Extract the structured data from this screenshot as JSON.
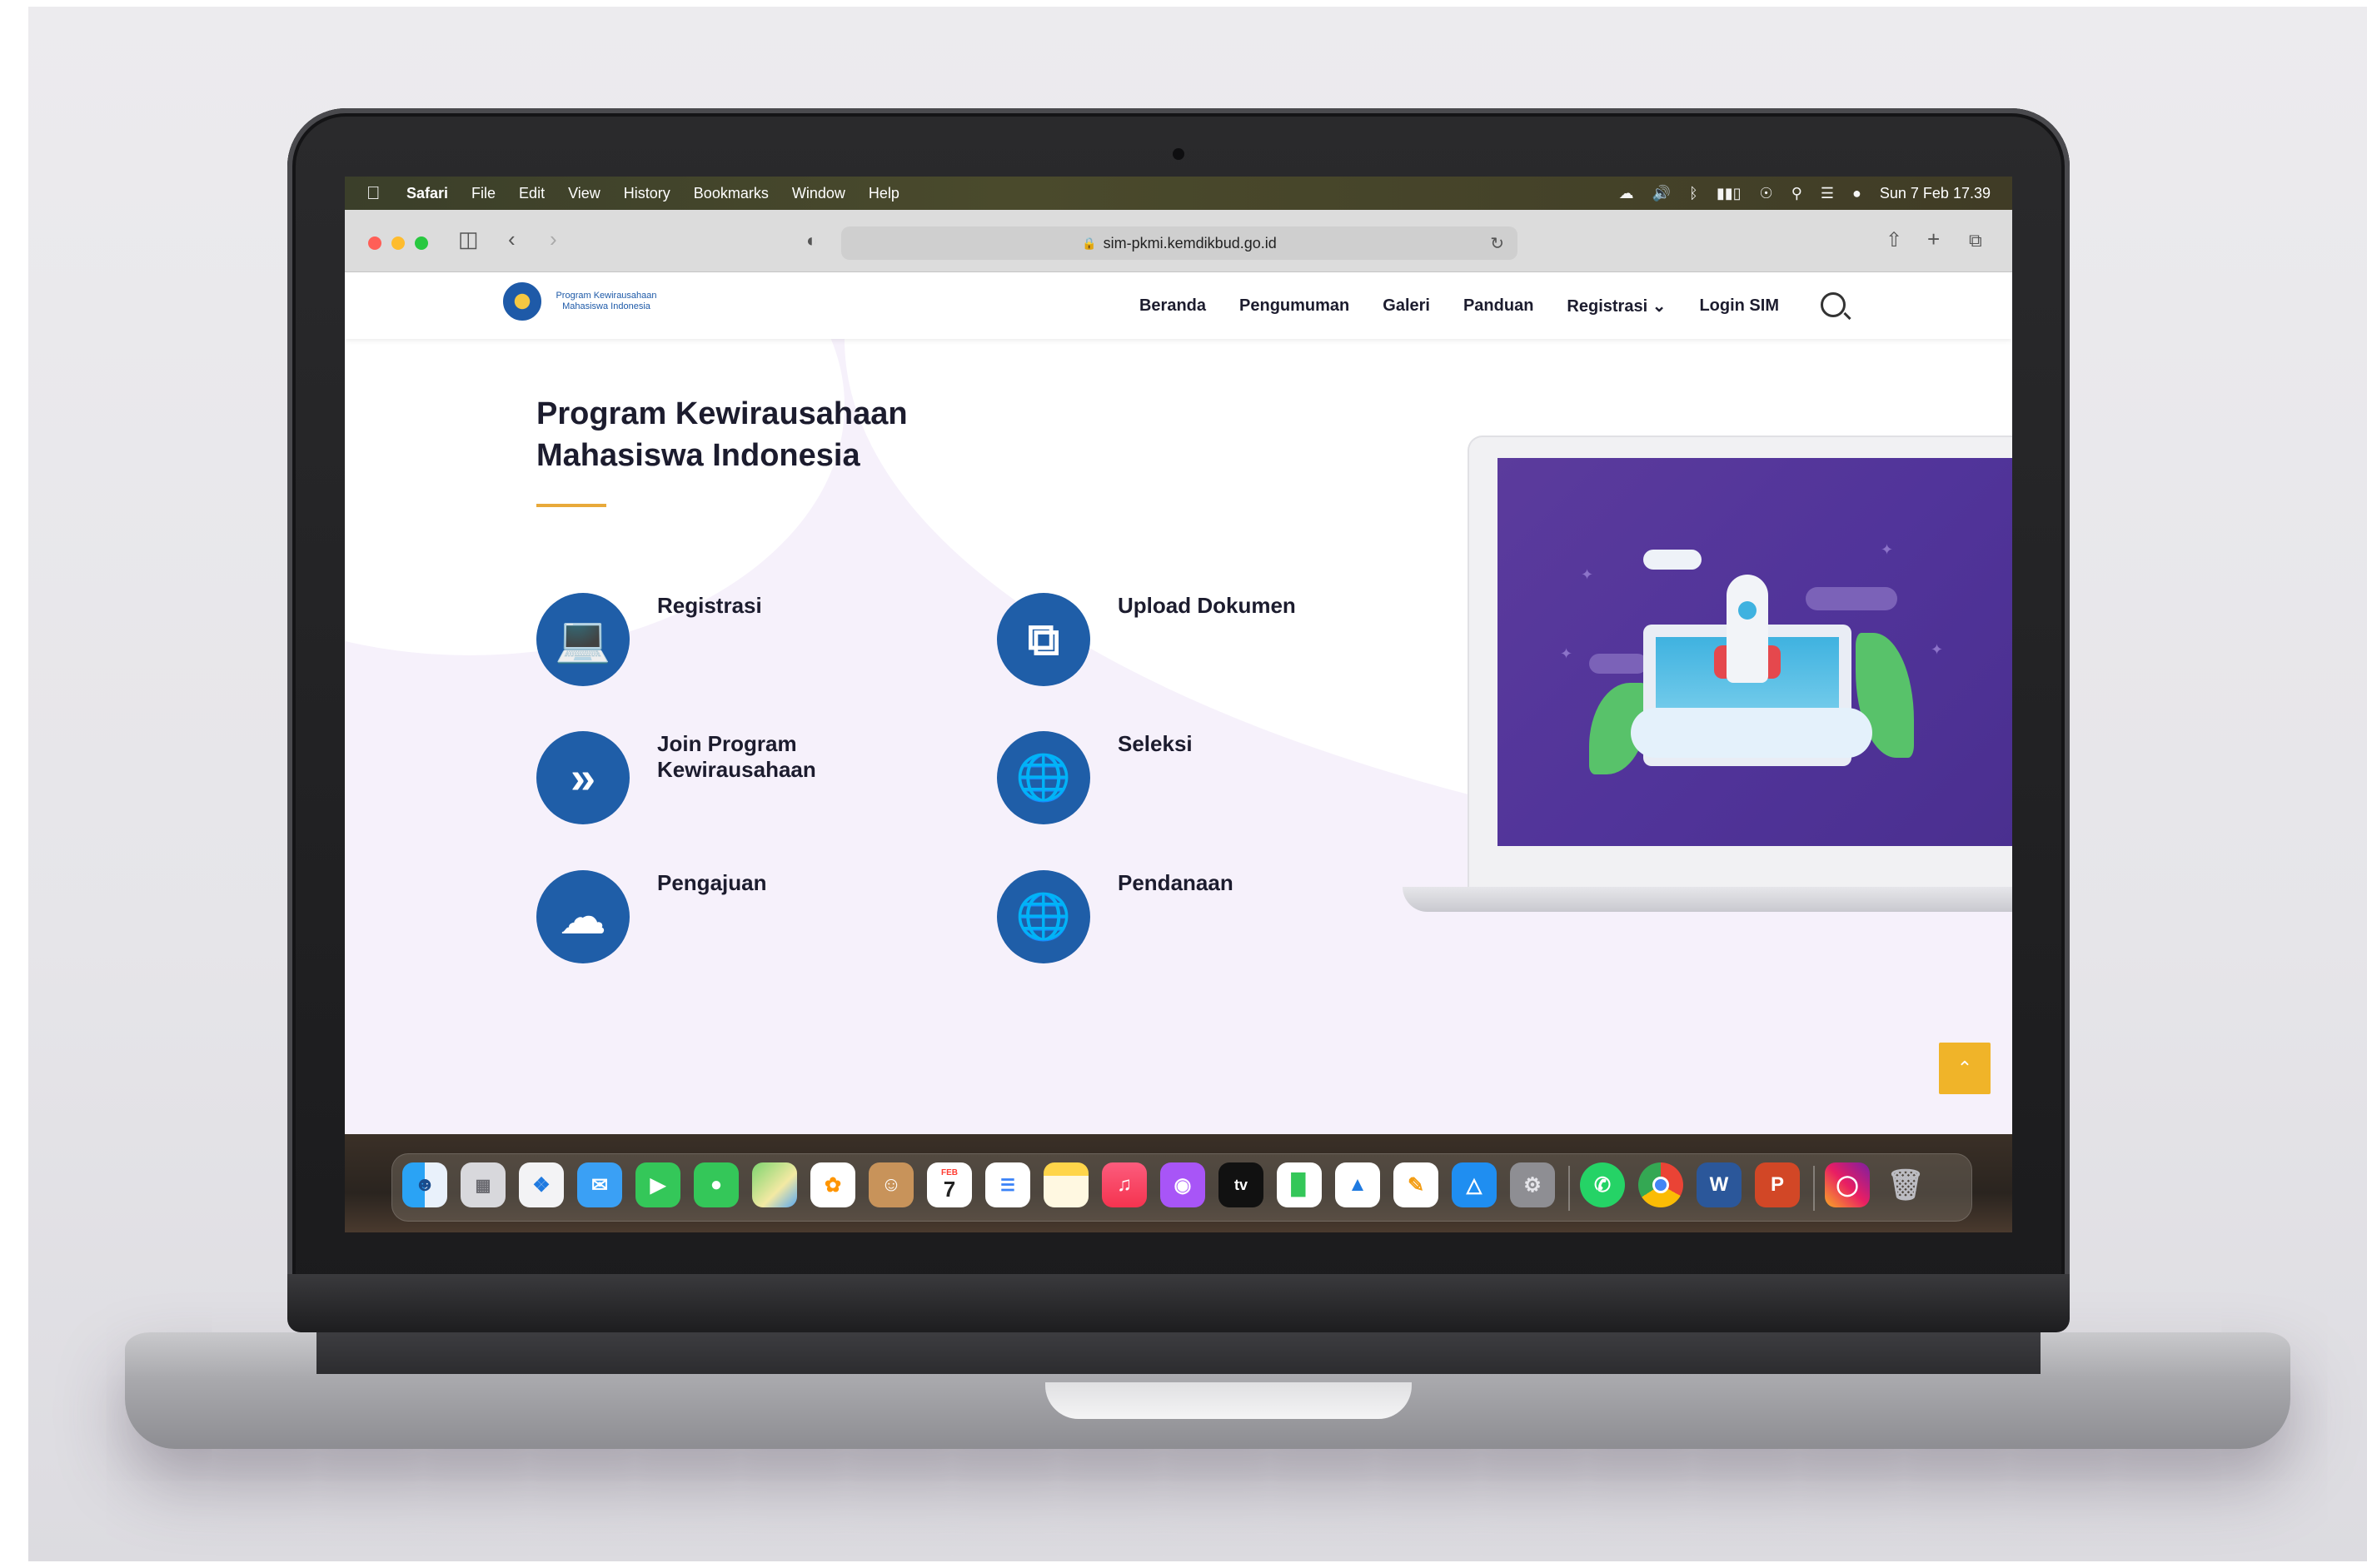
{
  "menubar": {
    "app": "Safari",
    "items": [
      "File",
      "Edit",
      "View",
      "History",
      "Bookmarks",
      "Window",
      "Help"
    ],
    "datetime": "Sun 7 Feb  17.39"
  },
  "browser": {
    "url": "sim-pkmi.kemdikbud.go.id"
  },
  "site": {
    "logo_text": "Program Kewirausahaan Mahasiswa Indonesia",
    "nav": [
      "Beranda",
      "Pengumuman",
      "Galeri",
      "Panduan",
      "Registrasi ⌄",
      "Login SIM"
    ],
    "hero_title": "Program Kewirausahaan Mahasiswa Indonesia",
    "features": [
      {
        "label": "Registrasi",
        "icon": "laptop-icon"
      },
      {
        "label": "Upload Dokumen",
        "icon": "copy-icon"
      },
      {
        "label": "Join Program Kewirausahaan",
        "icon": "double-chevron-icon"
      },
      {
        "label": "Seleksi",
        "icon": "globe-icon"
      },
      {
        "label": "Pengajuan",
        "icon": "cloud-upload-icon"
      },
      {
        "label": "Pendanaan",
        "icon": "globe-icon"
      }
    ]
  },
  "dock": {
    "apps": [
      "Finder",
      "Launchpad",
      "Safari",
      "Mail",
      "FaceTime",
      "Messages",
      "Maps",
      "Photos",
      "Contacts",
      "Calendar",
      "Reminders",
      "Notes",
      "Music",
      "Podcasts",
      "TV",
      "Numbers",
      "Keynote",
      "Pages",
      "App Store",
      "System Preferences",
      "WhatsApp",
      "Chrome",
      "Word",
      "PowerPoint",
      "Instagram",
      "Trash"
    ],
    "calendar_month": "FEB",
    "calendar_day": "7",
    "tv_label": "tv",
    "word_letter": "W",
    "ppt_letter": "P"
  },
  "colors": {
    "brand_blue": "#1f5ea8",
    "accent_gold": "#e8a93a",
    "scroll_button": "#f0b429",
    "hero_bg": "#f6f1fb"
  }
}
